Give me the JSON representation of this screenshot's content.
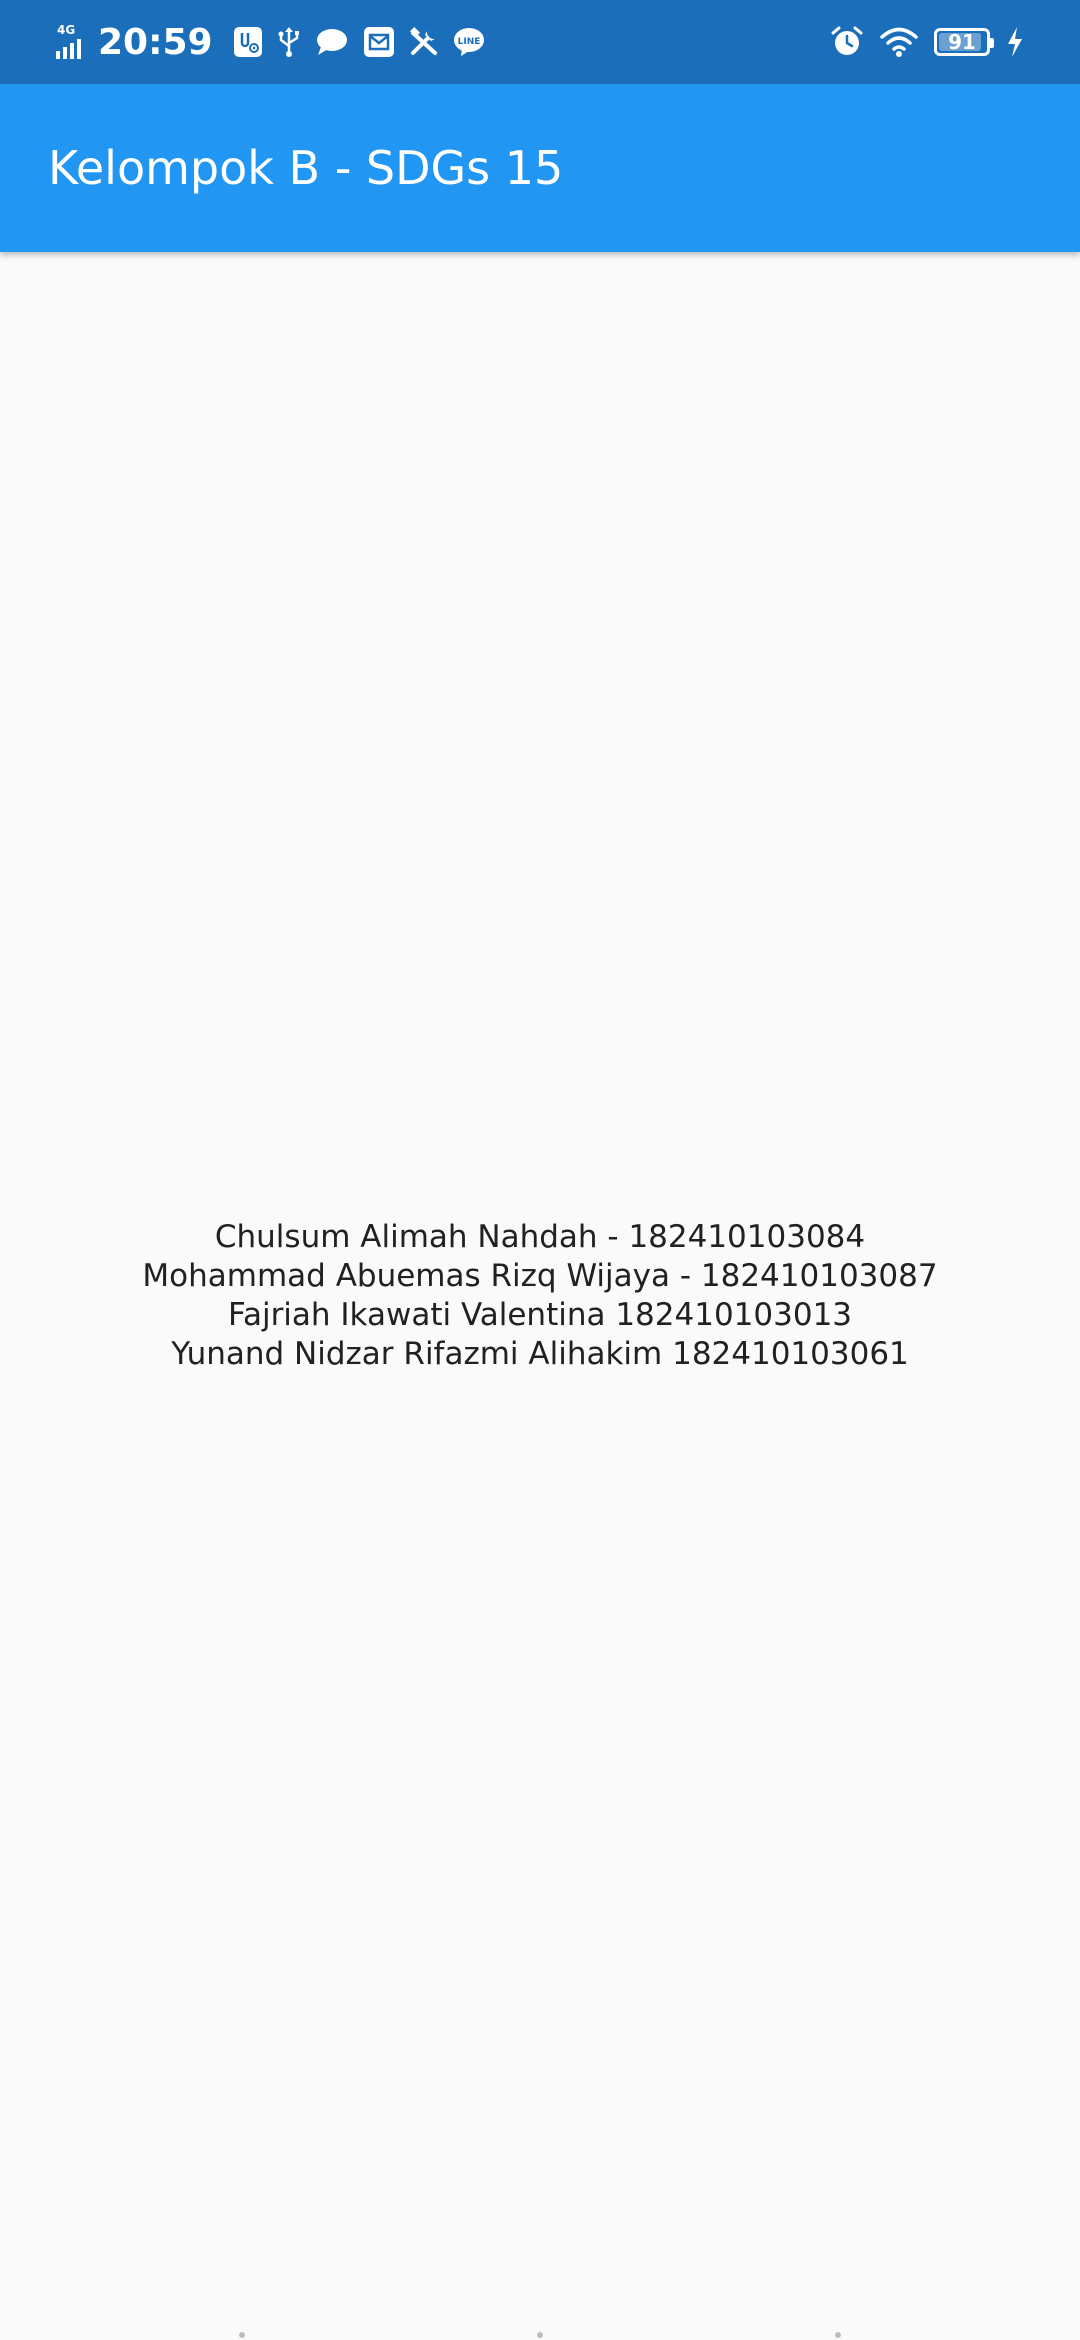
{
  "status_bar": {
    "network": "4G",
    "time": "20:59",
    "battery_level": "91",
    "battery_fraction": 0.91,
    "notification_icons": [
      "usb-debug-icon",
      "usb-icon",
      "chat-icon",
      "mail-icon",
      "tools-icon",
      "line-icon"
    ],
    "system_icons": [
      "alarm-icon",
      "wifi-icon",
      "battery-icon",
      "charging-icon"
    ],
    "background_color": "#1b6fba"
  },
  "app_bar": {
    "title": "Kelompok B - SDGs 15",
    "background_color": "#2196f3"
  },
  "members": [
    "Chulsum Alimah Nahdah - 182410103084",
    "Mohammad Abuemas Rizq Wijaya - 182410103087",
    "Fajriah Ikawati Valentina 182410103013",
    "Yunand Nidzar Rifazmi Alihakim 182410103061"
  ]
}
